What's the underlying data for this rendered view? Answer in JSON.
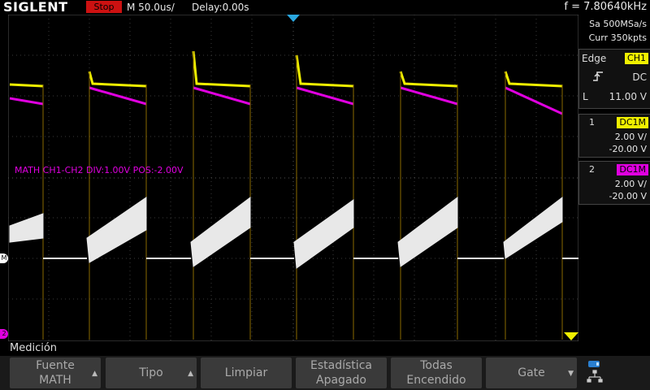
{
  "header": {
    "brand": "SIGLENT",
    "run_state": "Stop",
    "timebase": "M 50.0us/",
    "delay": "Delay:0.00s",
    "frequency": "f = 7.80640kHz"
  },
  "acquisition": {
    "sample_rate": "Sa 500MSa/s",
    "memory": "Curr 350kpts"
  },
  "trigger": {
    "type": "Edge",
    "source": "CH1",
    "coupling": "DC",
    "level_label": "L",
    "level": "11.00 V"
  },
  "channels": [
    {
      "num": "1",
      "coupling": "DC1M",
      "scale": "2.00 V/",
      "offset": "-20.00 V",
      "color": "#f0f000"
    },
    {
      "num": "2",
      "coupling": "DC1M",
      "scale": "2.00 V/",
      "offset": "-20.00 V",
      "color": "#e000e0"
    }
  ],
  "math": {
    "label": "MATH  CH1-CH2  DIV:1.00V  POS:-2.00V"
  },
  "markers": {
    "math": "M",
    "ch2": "2"
  },
  "menu": {
    "title": "Medición",
    "softkeys": [
      {
        "line1": "Fuente",
        "line2": "MATH",
        "arrow": "up"
      },
      {
        "line1": "Tipo",
        "line2": "",
        "arrow": "up"
      },
      {
        "line1": "Limpiar",
        "line2": "",
        "arrow": ""
      },
      {
        "line1": "Estadística",
        "line2": "Apagado",
        "arrow": ""
      },
      {
        "line1": "Todas",
        "line2": "Encendido",
        "arrow": ""
      },
      {
        "line1": "Gate",
        "line2": "",
        "arrow": "down"
      }
    ]
  },
  "icons": {
    "trigger_edge": "rising-edge-icon",
    "network": "network-icon",
    "trigger_position": "trigger-position-marker"
  }
}
